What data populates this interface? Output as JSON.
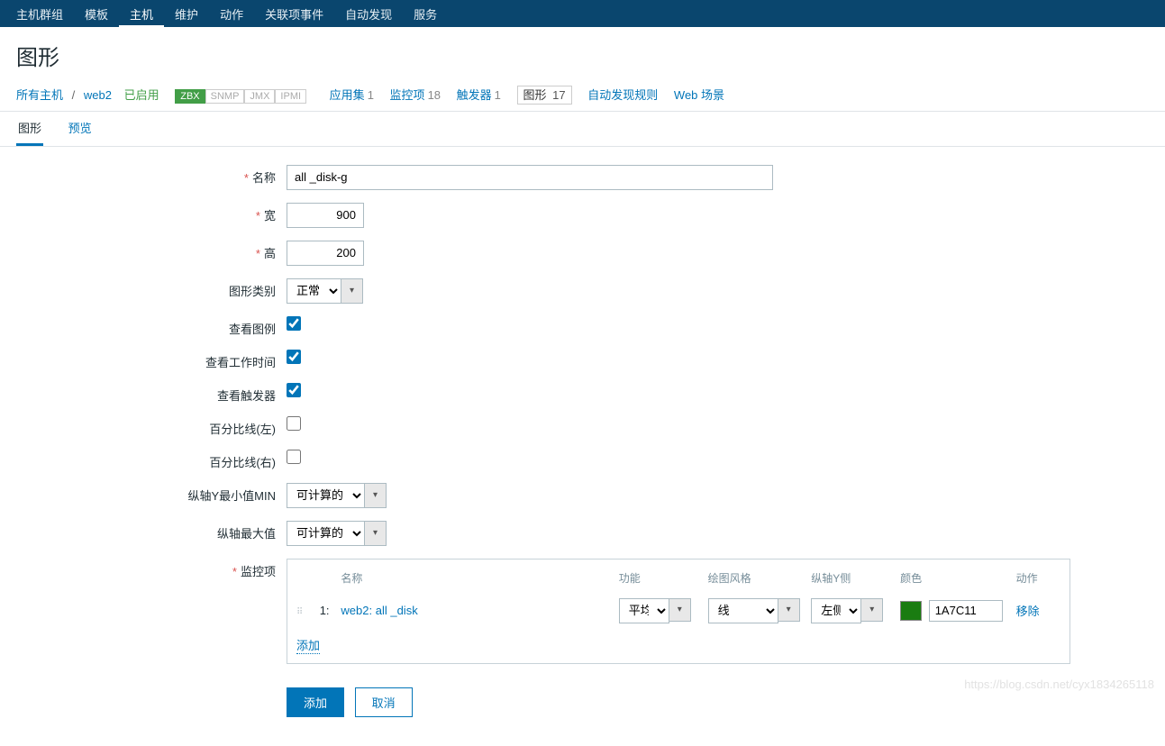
{
  "topnav": {
    "items": [
      "主机群组",
      "模板",
      "主机",
      "维护",
      "动作",
      "关联项事件",
      "自动发现",
      "服务"
    ],
    "active_index": 2
  },
  "page_title": "图形",
  "breadcrumb": {
    "all_hosts": "所有主机",
    "host": "web2",
    "status": "已启用",
    "badges": [
      "ZBX",
      "SNMP",
      "JMX",
      "IPMI"
    ],
    "links": [
      {
        "label": "应用集",
        "count": "1"
      },
      {
        "label": "监控项",
        "count": "18"
      },
      {
        "label": "触发器",
        "count": "1"
      }
    ],
    "current": {
      "label": "图形",
      "count": "17"
    },
    "after": [
      "自动发现规则",
      "Web 场景"
    ]
  },
  "tabs": {
    "items": [
      "图形",
      "预览"
    ],
    "active_index": 0
  },
  "form": {
    "name_label": "名称",
    "name_value": "all _disk-g",
    "width_label": "宽",
    "width_value": "900",
    "height_label": "高",
    "height_value": "200",
    "type_label": "图形类别",
    "type_value": "正常",
    "legend_label": "查看图例",
    "work_label": "查看工作时间",
    "trigger_label": "查看触发器",
    "pleft_label": "百分比线(左)",
    "pright_label": "百分比线(右)",
    "ymin_label": "纵轴Y最小值MIN",
    "ymin_value": "可计算的",
    "ymax_label": "纵轴最大值",
    "ymax_value": "可计算的",
    "items_label": "监控项"
  },
  "items_table": {
    "headers": {
      "name": "名称",
      "func": "功能",
      "style": "绘图风格",
      "side": "纵轴Y侧",
      "color": "颜色",
      "action": "动作"
    },
    "row": {
      "num": "1:",
      "name": "web2: all _disk",
      "func": "平均",
      "style": "线",
      "side": "左侧",
      "color_hex": "1A7C11",
      "color_swatch": "#1A7C11",
      "remove": "移除"
    },
    "add": "添加"
  },
  "buttons": {
    "submit": "添加",
    "cancel": "取消"
  },
  "watermark": "https://blog.csdn.net/cyx1834265118"
}
